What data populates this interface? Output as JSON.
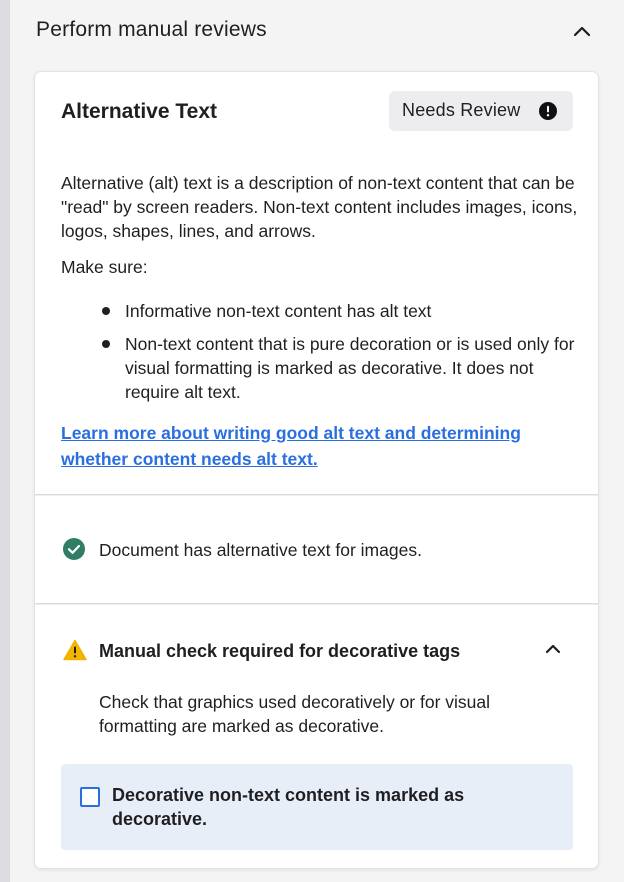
{
  "section": {
    "title": "Perform manual reviews",
    "chevron_icon": "chevron-up-icon"
  },
  "card": {
    "title": "Alternative Text",
    "status_badge": {
      "label": "Needs Review",
      "icon": "exclamation-circle-icon"
    },
    "description": "Alternative (alt) text is a description of non-text content that can be \"read\" by screen readers. Non-text content includes images, icons, logos, shapes, lines, and arrows.",
    "make_sure_label": "Make sure:",
    "bullets": [
      "Informative non-text content has alt text",
      "Non-text content that is pure decoration or is used only for visual formatting is marked as decorative. It does not require alt text."
    ],
    "learn_more_link": "Learn more about writing good alt text and determining whether content needs alt text.",
    "pass_check": {
      "icon": "check-circle-icon",
      "text": "Document has alternative text for images."
    },
    "manual_check": {
      "icon": "warning-triangle-icon",
      "title": "Manual check required for decorative tags",
      "description": "Check that graphics used decoratively or for visual formatting are marked as decorative.",
      "checkbox_label": "Decorative non-text content is marked as decorative.",
      "checked": false
    }
  },
  "colors": {
    "link": "#2a6fe0",
    "success": "#2e7d64",
    "warning": "#f2b400",
    "checkbox_box_bg": "#e8eef8",
    "badge_bg": "#ededef"
  }
}
